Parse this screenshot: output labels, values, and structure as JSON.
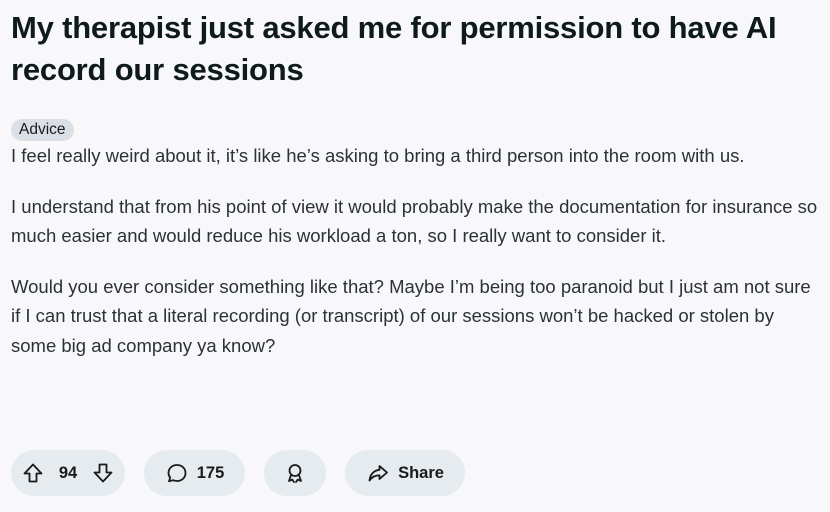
{
  "post": {
    "title": "My therapist just asked me for permission to have AI record our sessions",
    "flair": "Advice",
    "paragraphs": [
      "I feel really weird about it, it’s like he’s asking to bring a third person into the room with us.",
      "I understand that from his point of view it would probably make the documentation for insurance so much easier and would reduce his workload a ton, so I really want to consider it.",
      "Would you ever consider something like that? Maybe I’m being too paranoid but I just am not sure if I can trust that a literal recording (or transcript) of our sessions won’t be hacked or stolen by some big ad company ya know?"
    ]
  },
  "actions": {
    "vote_count": "94",
    "comment_count": "175",
    "share_label": "Share",
    "icons": {
      "upvote": "arrow-up-outline-icon",
      "downvote": "arrow-down-outline-icon",
      "comment": "speech-bubble-icon",
      "award": "award-ribbon-icon",
      "share": "share-arrow-icon"
    }
  }
}
